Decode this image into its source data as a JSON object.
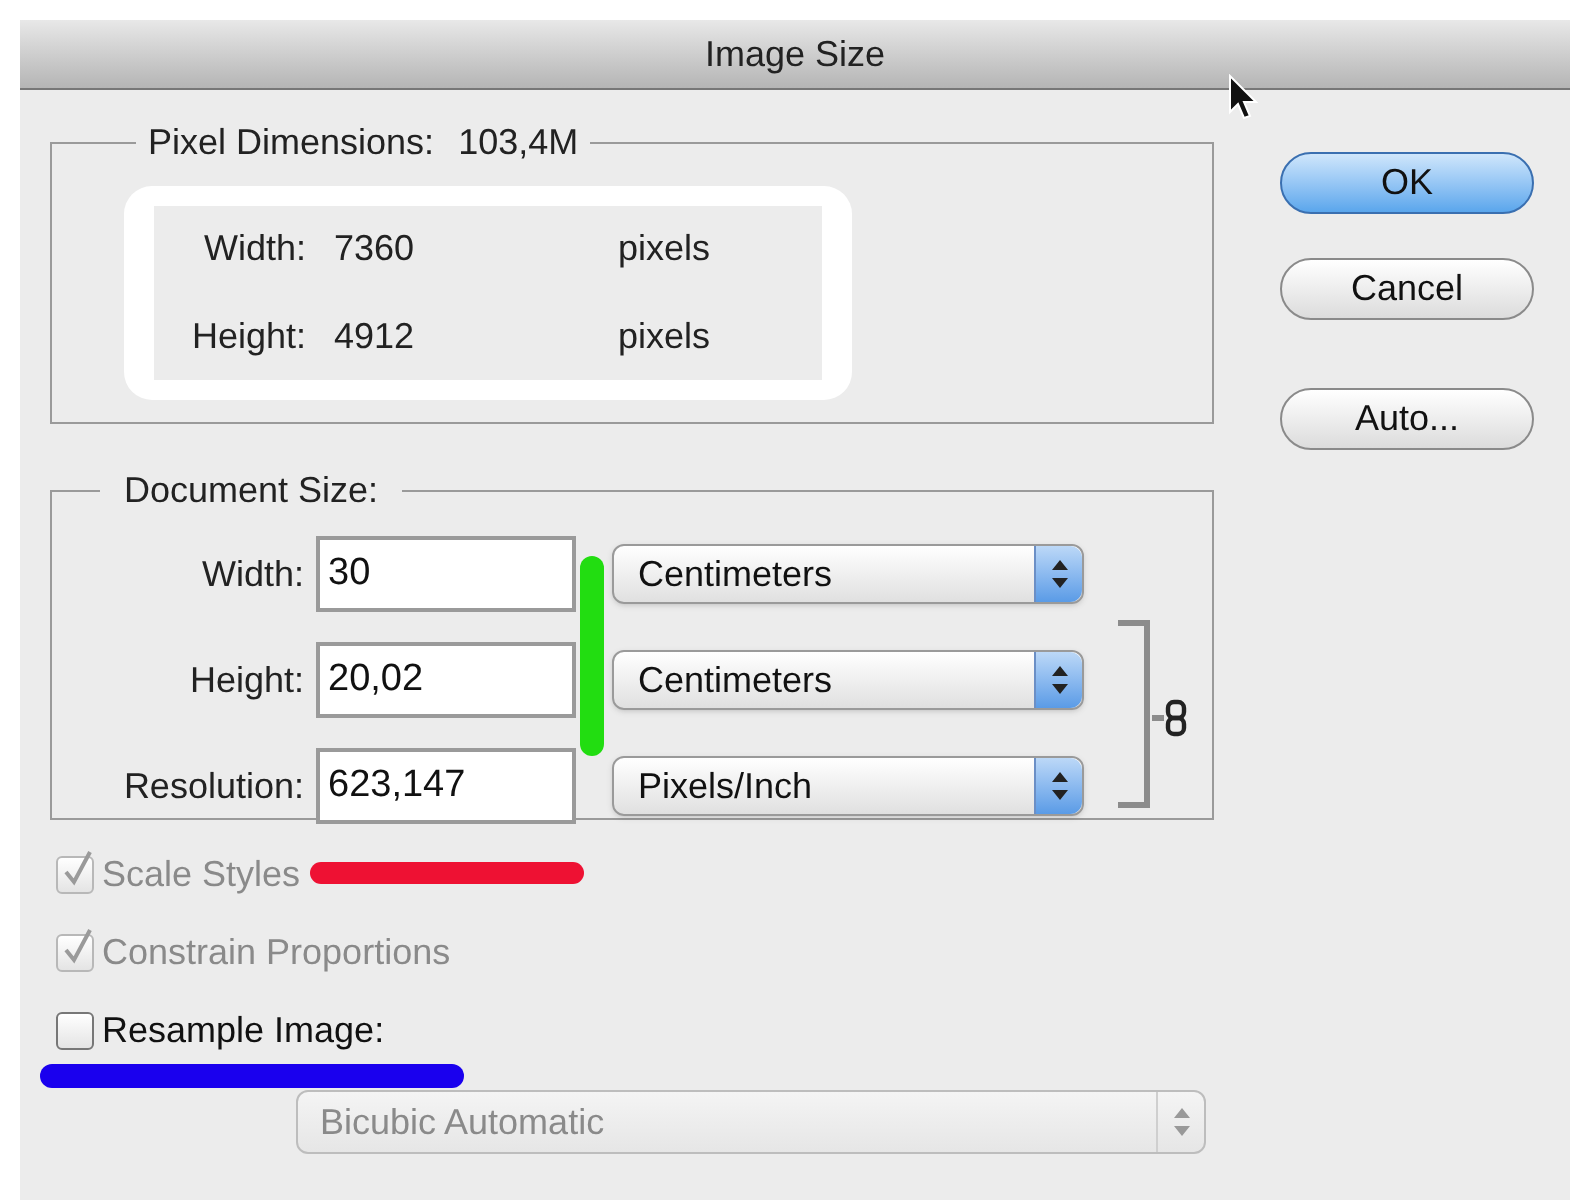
{
  "window": {
    "title": "Image Size"
  },
  "pixel_dimensions": {
    "label": "Pixel Dimensions:",
    "value": "103,4M",
    "rows": [
      {
        "label": "Width:",
        "value": "7360",
        "unit": "pixels"
      },
      {
        "label": "Height:",
        "value": "4912",
        "unit": "pixels"
      }
    ]
  },
  "document_size": {
    "label": "Document Size:",
    "rows": [
      {
        "label": "Width:",
        "value": "30",
        "unit": "Centimeters"
      },
      {
        "label": "Height:",
        "value": "20,02",
        "unit": "Centimeters"
      },
      {
        "label": "Resolution:",
        "value": "623,147",
        "unit": "Pixels/Inch"
      }
    ]
  },
  "options": [
    {
      "label": "Scale Styles",
      "checked": true,
      "disabled": true
    },
    {
      "label": "Constrain Proportions",
      "checked": true,
      "disabled": true
    },
    {
      "label": "Resample Image:",
      "checked": false,
      "disabled": false
    }
  ],
  "resample_method": {
    "value": "Bicubic Automatic",
    "disabled": true
  },
  "buttons": [
    {
      "label": "OK",
      "default": true
    },
    {
      "label": "Cancel",
      "default": false
    },
    {
      "label": "Auto...",
      "default": false
    }
  ]
}
